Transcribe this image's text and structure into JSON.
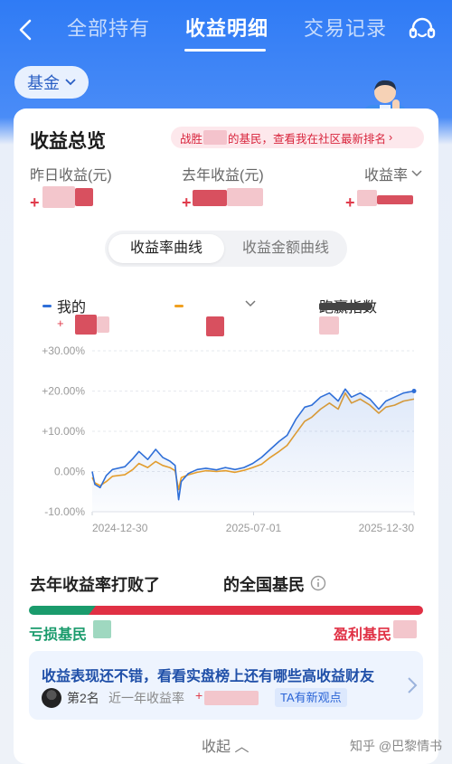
{
  "nav": {
    "tabs": [
      "全部持有",
      "收益明细",
      "交易记录"
    ],
    "active_tab": "收益明细"
  },
  "filter": {
    "label": "基金"
  },
  "card": {
    "title": "收益总览",
    "rank_banner_prefix": "战胜",
    "rank_banner_suffix": "的基民，查看我在社区最新排名",
    "metrics": [
      {
        "label": "昨日收益(元)",
        "sign": "+"
      },
      {
        "label": "去年收益(元)",
        "sign": "+"
      },
      {
        "label": "收益率",
        "sign": "+"
      }
    ],
    "toggle": {
      "options": [
        "收益率曲线",
        "收益金额曲线"
      ],
      "selected": "收益率曲线"
    },
    "legend": {
      "mine_label": "我的",
      "benchmark_label": "跑赢指数",
      "mine_color": "#2f6fd8",
      "compare_color": "#f0a020"
    }
  },
  "chart_data": {
    "type": "line",
    "y_ticks": [
      "+30.00%",
      "+20.00%",
      "+10.00%",
      "0.00%",
      "-10.00%"
    ],
    "x_ticks": [
      "2024-12-30",
      "2025-07-01",
      "2025-12-30"
    ],
    "ylim": [
      -10,
      30
    ],
    "x_range": [
      "2024-12-30",
      "2025-12-30"
    ],
    "grid": true,
    "series": [
      {
        "name": "我的",
        "color": "#2f6fd8",
        "points": [
          [
            "2024-12-30",
            0.0
          ],
          [
            "2025-01-02",
            -3.2
          ],
          [
            "2025-01-08",
            -4.0
          ],
          [
            "2025-01-15",
            -1.0
          ],
          [
            "2025-01-22",
            0.5
          ],
          [
            "2025-02-05",
            1.2
          ],
          [
            "2025-02-14",
            3.2
          ],
          [
            "2025-02-21",
            5.0
          ],
          [
            "2025-03-03",
            3.0
          ],
          [
            "2025-03-12",
            5.5
          ],
          [
            "2025-03-20",
            3.5
          ],
          [
            "2025-03-28",
            2.6
          ],
          [
            "2025-04-03",
            1.5
          ],
          [
            "2025-04-07",
            -7.0
          ],
          [
            "2025-04-10",
            -2.5
          ],
          [
            "2025-04-18",
            -0.5
          ],
          [
            "2025-04-28",
            0.5
          ],
          [
            "2025-05-08",
            0.8
          ],
          [
            "2025-05-20",
            0.4
          ],
          [
            "2025-05-30",
            1.0
          ],
          [
            "2025-06-10",
            0.5
          ],
          [
            "2025-06-20",
            1.0
          ],
          [
            "2025-06-30",
            2.0
          ],
          [
            "2025-07-10",
            3.5
          ],
          [
            "2025-07-20",
            5.5
          ],
          [
            "2025-07-30",
            7.5
          ],
          [
            "2025-08-08",
            9.0
          ],
          [
            "2025-08-18",
            13.0
          ],
          [
            "2025-08-28",
            16.0
          ],
          [
            "2025-09-05",
            16.5
          ],
          [
            "2025-09-15",
            18.5
          ],
          [
            "2025-09-25",
            19.5
          ],
          [
            "2025-10-05",
            17.5
          ],
          [
            "2025-10-13",
            20.5
          ],
          [
            "2025-10-20",
            18.5
          ],
          [
            "2025-10-30",
            19.5
          ],
          [
            "2025-11-10",
            18.0
          ],
          [
            "2025-11-20",
            15.5
          ],
          [
            "2025-11-28",
            17.5
          ],
          [
            "2025-12-08",
            18.5
          ],
          [
            "2025-12-18",
            19.5
          ],
          [
            "2025-12-30",
            20.0
          ]
        ]
      },
      {
        "name": "",
        "color": "#f0a020",
        "points": [
          [
            "2024-12-30",
            -1.5
          ],
          [
            "2025-01-02",
            -2.8
          ],
          [
            "2025-01-08",
            -3.5
          ],
          [
            "2025-01-15",
            -2.5
          ],
          [
            "2025-01-22",
            -1.2
          ],
          [
            "2025-02-05",
            -0.8
          ],
          [
            "2025-02-14",
            0.5
          ],
          [
            "2025-02-21",
            2.0
          ],
          [
            "2025-03-03",
            1.0
          ],
          [
            "2025-03-12",
            2.5
          ],
          [
            "2025-03-20",
            1.5
          ],
          [
            "2025-03-28",
            1.0
          ],
          [
            "2025-04-03",
            0.2
          ],
          [
            "2025-04-07",
            -4.5
          ],
          [
            "2025-04-10",
            -1.5
          ],
          [
            "2025-04-18",
            -0.8
          ],
          [
            "2025-04-28",
            -0.2
          ],
          [
            "2025-05-08",
            0.2
          ],
          [
            "2025-05-20",
            0.0
          ],
          [
            "2025-05-30",
            0.2
          ],
          [
            "2025-06-10",
            -0.2
          ],
          [
            "2025-06-20",
            0.3
          ],
          [
            "2025-06-30",
            1.0
          ],
          [
            "2025-07-10",
            1.8
          ],
          [
            "2025-07-20",
            3.5
          ],
          [
            "2025-07-30",
            5.0
          ],
          [
            "2025-08-08",
            6.5
          ],
          [
            "2025-08-18",
            9.5
          ],
          [
            "2025-08-28",
            12.5
          ],
          [
            "2025-09-05",
            13.5
          ],
          [
            "2025-09-15",
            15.5
          ],
          [
            "2025-09-25",
            17.0
          ],
          [
            "2025-10-05",
            15.5
          ],
          [
            "2025-10-13",
            19.5
          ],
          [
            "2025-10-20",
            17.0
          ],
          [
            "2025-10-30",
            18.0
          ],
          [
            "2025-11-10",
            16.5
          ],
          [
            "2025-11-20",
            14.5
          ],
          [
            "2025-11-28",
            16.0
          ],
          [
            "2025-12-08",
            16.5
          ],
          [
            "2025-12-18",
            17.5
          ],
          [
            "2025-12-30",
            18.0
          ]
        ]
      }
    ]
  },
  "beat": {
    "prefix": "去年收益率打败了",
    "suffix": "的全国基民",
    "loss_label": "亏损基民",
    "profit_label": "盈利基民"
  },
  "promo": {
    "title": "收益表现还不错，看看实盘榜上还有哪些高收益财友",
    "rank": "第2名",
    "rate_label": "近一年收益率",
    "rate_sign": "+",
    "tag": "TA有新观点"
  },
  "collapse_label": "收起",
  "watermark": "知乎 @巴黎情书"
}
